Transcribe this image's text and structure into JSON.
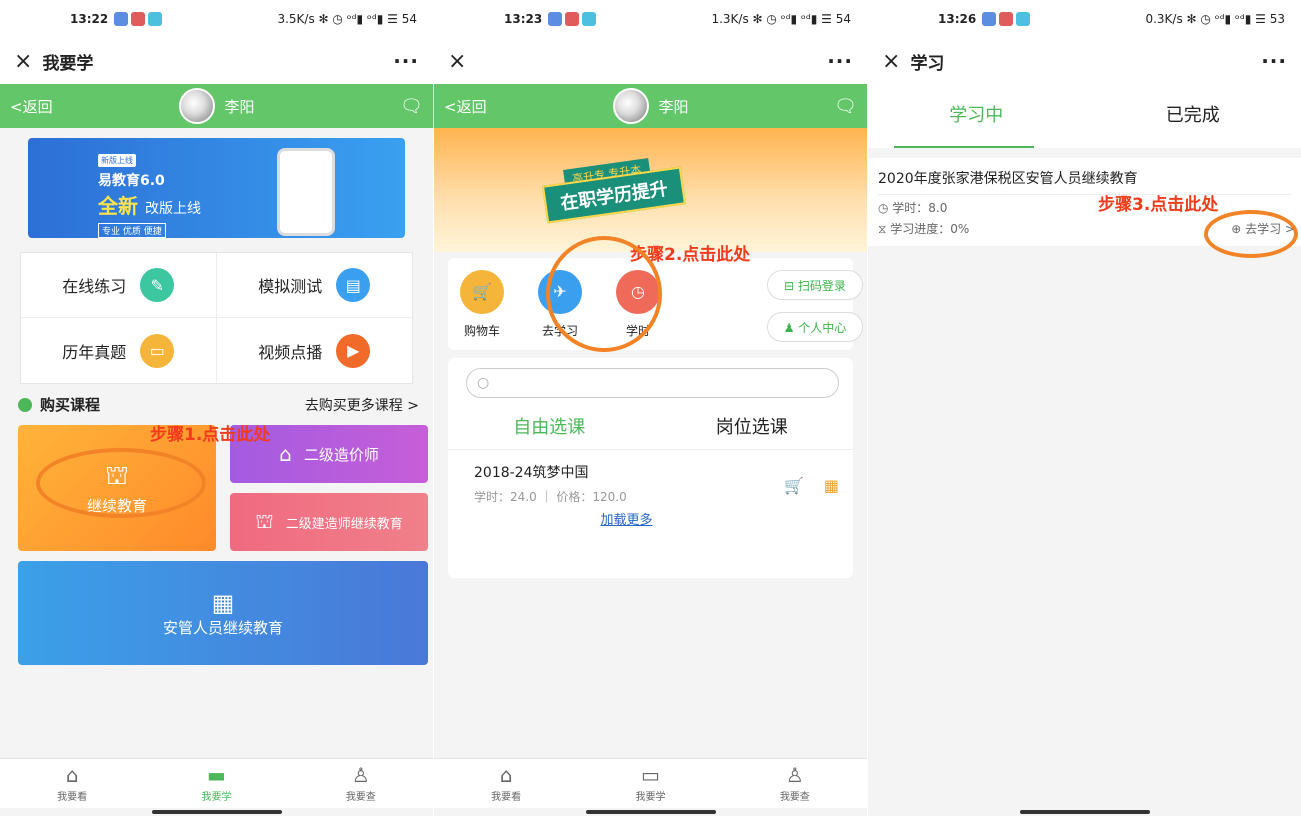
{
  "panel1": {
    "status": {
      "time": "13:22",
      "net": "3.5K/s ✻ ◷ ᵒᵈ▮ ᵒᵈ▮ ☰ 54"
    },
    "title": "我要学",
    "back": "<返回",
    "username": "李阳",
    "banner": {
      "tag": "新版上线",
      "line1": "易教育6.0",
      "line2": "全新",
      "line2b": "改版上线",
      "line3": "专业 优质 便捷"
    },
    "grid": [
      {
        "label": "在线练习",
        "icon": "✎",
        "color": "#3cc7a0"
      },
      {
        "label": "模拟测试",
        "icon": "▤",
        "color": "#3b9ff0"
      },
      {
        "label": "历年真题",
        "icon": "▭",
        "color": "#f5b53a"
      },
      {
        "label": "视频点播",
        "icon": "▶",
        "color": "#f06a2a"
      }
    ],
    "section": {
      "title": "购买课程",
      "more": "去购买更多课程 >"
    },
    "tiles": {
      "t1": "继续教育",
      "t2": "二级造价师",
      "t3": "二级建造师继续教育",
      "t4": "安管人员继续教育"
    },
    "annotation": "步骤1.点击此处",
    "tabs": [
      {
        "label": "我要看",
        "icon": "⌂"
      },
      {
        "label": "我要学",
        "icon": "▬"
      },
      {
        "label": "我要查",
        "icon": "♙"
      }
    ]
  },
  "panel2": {
    "status": {
      "time": "13:23",
      "net": "1.3K/s ✻ ◷ ᵒᵈ▮ ᵒᵈ▮ ☰ 54"
    },
    "back": "<返回",
    "username": "李阳",
    "banner": {
      "small": "高升专 专升本",
      "big": "在职学历提升"
    },
    "icons": [
      {
        "label": "购物车",
        "icon": "🛒",
        "color": "#f5b53a"
      },
      {
        "label": "去学习",
        "icon": "✈",
        "color": "#3b9ff0"
      },
      {
        "label": "学时",
        "icon": "◷",
        "color": "#f06a5a"
      }
    ],
    "side": {
      "scan": "⊟ 扫码登录",
      "center": "♟ 个人中心"
    },
    "annotation": "步骤2.点击此处",
    "search_icon": "○",
    "seltabs": {
      "free": "自由选课",
      "post": "岗位选课"
    },
    "course": {
      "name": "2018-24筑梦中国",
      "meta": "学时：24.0 ｜ 价格：120.0",
      "load": "加载更多"
    },
    "tabs": [
      {
        "label": "我要看",
        "icon": "⌂"
      },
      {
        "label": "我要学",
        "icon": "▭"
      },
      {
        "label": "我要查",
        "icon": "♙"
      }
    ]
  },
  "panel3": {
    "status": {
      "time": "13:26",
      "net": "0.3K/s ✻ ◷ ᵒᵈ▮ ᵒᵈ▮ ☰ 53"
    },
    "title": "学习",
    "tabs": {
      "learning": "学习中",
      "done": "已完成"
    },
    "course": {
      "name": "2020年度张家港保税区安管人员继续教育",
      "hours": "◷ 学时：8.0",
      "progress": "⧖ 学习进度：0%",
      "go": "⊕ 去学习 >"
    },
    "annotation": "步骤3.点击此处"
  }
}
